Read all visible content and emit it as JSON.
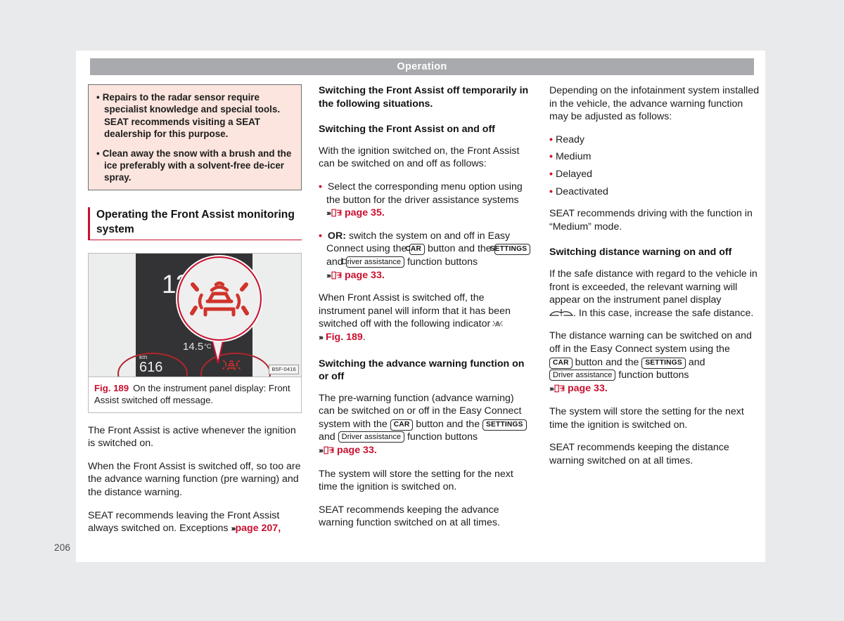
{
  "page": {
    "number": "206",
    "running_header": "Operation"
  },
  "colors": {
    "accent_red": "#c8102e",
    "header_gray": "#a8aaad",
    "notice_bg": "#fbe5de",
    "notice_border": "#6d6e70",
    "cluster_bg": "#333335"
  },
  "notice_box": {
    "items": [
      "Repairs to the radar sensor require specialist knowledge and special tools. SEAT recommends visiting a SEAT dealership for this purpose.",
      "Clean away the snow with a brush and the ice preferably with a solvent-free de-icer spray."
    ]
  },
  "section": {
    "heading": "Operating the Front Assist monitoring system"
  },
  "figure": {
    "label": "Fig. 189",
    "caption": "On the instrument panel display: Front Assist switched off message.",
    "image_code": "B5F-0416",
    "cluster": {
      "speed": "120",
      "temperature": "14.5",
      "temperature_unit": "°C",
      "odometer_unit": "km",
      "odometer_value": "616"
    }
  },
  "left_column": {
    "paragraphs": [
      "The Front Assist is active whenever the ignition is switched on.",
      "When the Front Assist is switched off, so too are the advance warning function (pre warning) and the distance warning."
    ],
    "last_paragraph_prefix": "SEAT recommends leaving the Front Assist always switched on. Exceptions",
    "last_paragraph_ref": "page 207,"
  },
  "middle_column": {
    "lead": "Switching the Front Assist off temporarily in the following situations.",
    "heading_1": "Switching the Front Assist on and off",
    "para_1": "With the ignition switched on, the Front Assist can be switched on and off as follows:",
    "bullet_1_text": "Select the corresponding menu option using the button for the driver assistance systems",
    "bullet_1_ref": "page 35.",
    "bullet_2_prefix": "OR:",
    "bullet_2_part_a": "switch the system on and off in Easy Connect using the",
    "bullet_2_chip_1": "CAR",
    "bullet_2_part_b": "button and the",
    "bullet_2_chip_2": "SETTINGS",
    "bullet_2_part_c": "and",
    "bullet_2_chip_3": "Driver assistance",
    "bullet_2_part_d": "function buttons",
    "bullet_2_ref": "page 33.",
    "para_2_prefix": "When Front Assist is switched off, the instrument panel will inform that it has been switched off with the following indicator",
    "para_2_ref": "Fig. 189",
    "heading_2": "Switching the advance warning function on or off",
    "para_3_part_a": "The pre-warning function (advance warning) can be switched on or off in the Easy Connect system with the",
    "para_3_chip_1": "CAR",
    "para_3_part_b": "button and the",
    "para_3_chip_2": "SETTINGS",
    "para_3_part_c": "and",
    "para_3_chip_3": "Driver assistance",
    "para_3_part_d": "function buttons",
    "para_3_ref": "page 33.",
    "para_4": "The system will store the setting for the next time the ignition is switched on.",
    "para_5": "SEAT recommends keeping the advance warning function switched on at all times."
  },
  "right_column": {
    "para_1": "Depending on the infotainment system installed in the vehicle, the advance warning function may be adjusted as follows:",
    "options": [
      "Ready",
      "Medium",
      "Delayed",
      "Deactivated"
    ],
    "para_2": "SEAT recommends driving with the function in “Medium” mode.",
    "heading_1": "Switching distance warning on and off",
    "para_3_part_a": "If the safe distance with regard to the vehicle in front is exceeded, the relevant warning will appear on the instrument panel display",
    "para_3_part_b": ". In this case, increase the safe distance.",
    "para_4_part_a": "The distance warning can be switched on and off in the Easy Connect system using the",
    "para_4_chip_1": "CAR",
    "para_4_part_b": "button and the",
    "para_4_chip_2": "SETTINGS",
    "para_4_part_c": "and",
    "para_4_chip_3": "Driver assistance",
    "para_4_part_d": "function buttons",
    "para_4_ref": "page 33.",
    "para_5": "The system will store the setting for the next time the ignition is switched on.",
    "para_6": "SEAT recommends keeping the distance warning switched on at all times."
  }
}
